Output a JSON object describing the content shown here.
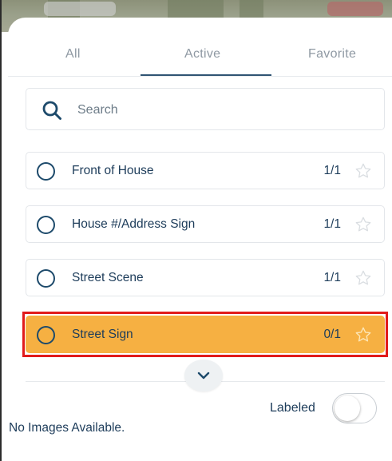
{
  "tabs": [
    {
      "label": "All"
    },
    {
      "label": "Active"
    },
    {
      "label": "Favorite"
    }
  ],
  "active_tab": "Active",
  "search": {
    "placeholder": "Search",
    "value": ""
  },
  "items": [
    {
      "label": "Front of House",
      "count": "1/1",
      "favorite": false,
      "selected": false
    },
    {
      "label": "House #/Address Sign",
      "count": "1/1",
      "favorite": false,
      "selected": false
    },
    {
      "label": "Street Scene",
      "count": "1/1",
      "favorite": false,
      "selected": false
    },
    {
      "label": "Street Sign",
      "count": "0/1",
      "favorite": false,
      "selected": false,
      "highlighted": true
    }
  ],
  "footer": {
    "labeled_label": "Labeled",
    "labeled_on": false,
    "no_images_text": "No Images Available."
  },
  "colors": {
    "primary": "#1d4a6b",
    "highlight_row": "#f6b042",
    "highlight_frame": "#e11b1b",
    "tab_text": "#8f99a3"
  },
  "icons": {
    "search": "search-icon",
    "radio": "radio-icon",
    "star": "star-outline-icon",
    "expand": "chevron-down-icon"
  }
}
